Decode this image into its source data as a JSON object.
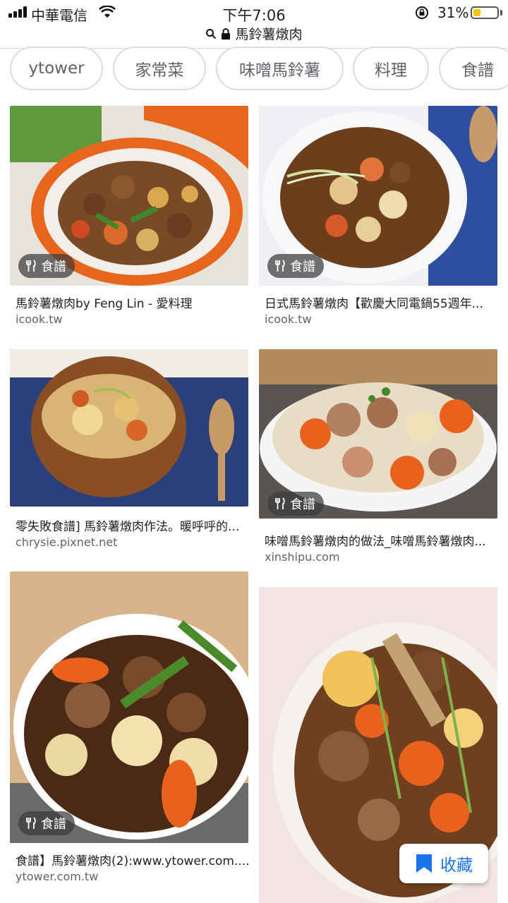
{
  "status": {
    "carrier": "中華電信",
    "time": "下午7:06",
    "battery": "31%",
    "battery_level": 0.31
  },
  "url": {
    "query": "馬鈴薯燉肉",
    "search_icon": "search-icon",
    "lock_icon": "lock-icon"
  },
  "chips": [
    "ytower",
    "家常菜",
    "味噌馬鈴薯",
    "料理",
    "食譜"
  ],
  "results": [
    {
      "title": "馬鈴薯燉肉by Feng Lin - 愛料理",
      "source": "icook.tw",
      "badge": "食譜"
    },
    {
      "title": "日式馬鈴薯燉肉【歡慶大同電鍋55週年...",
      "source": "icook.tw",
      "badge": "食譜"
    },
    {
      "title": "零失敗食譜] 馬鈴薯燉肉作法。暖呼呼的...",
      "source": "chrysie.pixnet.net",
      "badge": ""
    },
    {
      "title": "味噌馬鈴薯燉肉的做法_味噌馬鈴薯燉肉...",
      "source": "xinshipu.com",
      "badge": "食譜"
    },
    {
      "title": "食譜】馬鈴薯燉肉(2):www.ytower.com....",
      "source": "ytower.com.tw",
      "badge": "食譜"
    }
  ],
  "save": {
    "label": "收藏"
  },
  "colors": {
    "accent": "#1a73e8",
    "chip_border": "#dadce0"
  }
}
